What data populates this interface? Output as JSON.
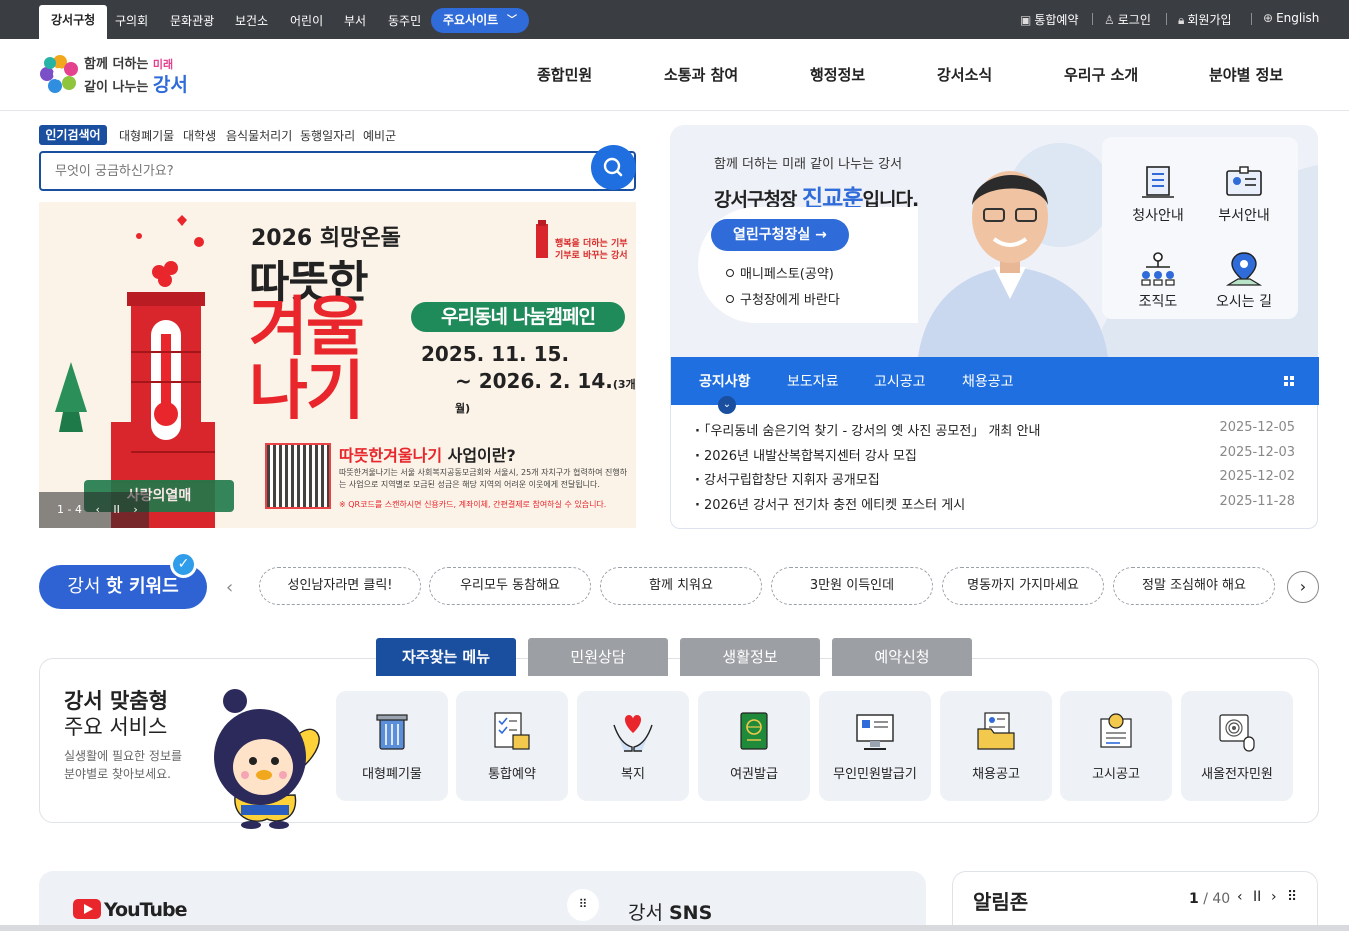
{
  "topbar": {
    "tabs": [
      "강서구청",
      "구의회",
      "문화관광",
      "보건소",
      "어린이",
      "부서",
      "동주민"
    ],
    "main_sites": "주요사이트",
    "utils": [
      "통합예약",
      "로그인",
      "회원가입",
      "English"
    ]
  },
  "logo": {
    "line1": "함께 더하는",
    "line1_accent": "미래",
    "line2": "같이 나누는",
    "line2_accent": "강서"
  },
  "gnb": [
    "종합민원",
    "소통과 참여",
    "행정정보",
    "강서소식",
    "우리구 소개",
    "분야별 정보"
  ],
  "search": {
    "popular_label": "인기검색어",
    "popular": [
      "대형폐기물",
      "대학생",
      "음식물처리기",
      "동행일자리",
      "예비군"
    ],
    "placeholder": "무엇이 궁금하신가요?"
  },
  "banner": {
    "year_title": "2026 희망온돌",
    "line1": "따뜻한",
    "line2": "겨울",
    "line3": "나기",
    "campaign": "우리동네 나눔캠페인",
    "date_from": "2025. 11. 15.",
    "date_to": "~ 2026. 2. 14.",
    "date_note": "(3개월)",
    "small_line1": "행복을 더하는 기부",
    "small_line2": "기부로 바꾸는 강서",
    "q_title_red": "따뜻한겨울나기",
    "q_title_black": " 사업이란?",
    "q_desc": "따뜻한겨울나기는 서울 사회복지공동모금회와 서울시, 25개 자치구가 협력하여 진행하는 사업으로 지역별로 모금된 성금은 해당 지역의 어려운 이웃에게 전달됩니다.",
    "q_note": "※ QR코드를 스캔하시면 신용카드, 계좌이체, 간편결제로 참여하실 수 있습니다.",
    "love": "사랑의열매",
    "counter": "1 - 4",
    "ctrl_prev": "‹",
    "ctrl_pause": "II",
    "ctrl_next": "›"
  },
  "mayor": {
    "sub": "함께 더하는 미래 같이 나누는 강서",
    "title_pre": "강서구청장 ",
    "name": "진교훈",
    "title_post": "입니다.",
    "open_office": "열린구청장실 →",
    "links": [
      "매니페스토(공약)",
      "구청장에게 바란다"
    ],
    "quick": [
      "청사안내",
      "부서안내",
      "조직도",
      "오시는 길"
    ]
  },
  "notice": {
    "tabs": [
      "공지사항",
      "보도자료",
      "고시공고",
      "채용공고"
    ],
    "items": [
      {
        "title": "「우리동네 숨은기억 찾기 - 강서의 옛 사진 공모전」 개최 안내",
        "date": "2025-12-05"
      },
      {
        "title": "2026년 내발산복합복지센터 강사 모집",
        "date": "2025-12-03"
      },
      {
        "title": "강서구립합창단 지휘자 공개모집",
        "date": "2025-12-02"
      },
      {
        "title": "2026년 강서구 전기차 충전 에티켓 포스터 게시",
        "date": "2025-11-28"
      }
    ]
  },
  "hot": {
    "label_pre": "강서 ",
    "label_bold": "핫 키워드",
    "chips": [
      "성인남자라면 클릭!",
      "우리모두 동참해요",
      "함께 치워요",
      "3만원 이득인데",
      "명동까지 가지마세요",
      "정말 조심해야 해요"
    ]
  },
  "menu": {
    "tabs": [
      "자주찾는 메뉴",
      "민원상담",
      "생활정보",
      "예약신청"
    ],
    "heading1": "강서 맞춤형",
    "heading2": "주요 서비스",
    "desc": "실생활에 필요한 정보를 분야별로 찾아보세요.",
    "services": [
      "대형폐기물",
      "통합예약",
      "복지",
      "여권발급",
      "무인민원발급기",
      "채용공고",
      "고시공고",
      "새올전자민원"
    ]
  },
  "bottom": {
    "youtube": "YouTube",
    "sns_pre": "강서 ",
    "sns_bold": "SNS",
    "alarm": "알림존",
    "alarm_page": "1",
    "alarm_total": " / 40"
  },
  "colors": {
    "primary": "#1f6fe0",
    "navy": "#1a4fa0",
    "accent_red": "#e8262c",
    "topbar": "#3a3d42"
  }
}
